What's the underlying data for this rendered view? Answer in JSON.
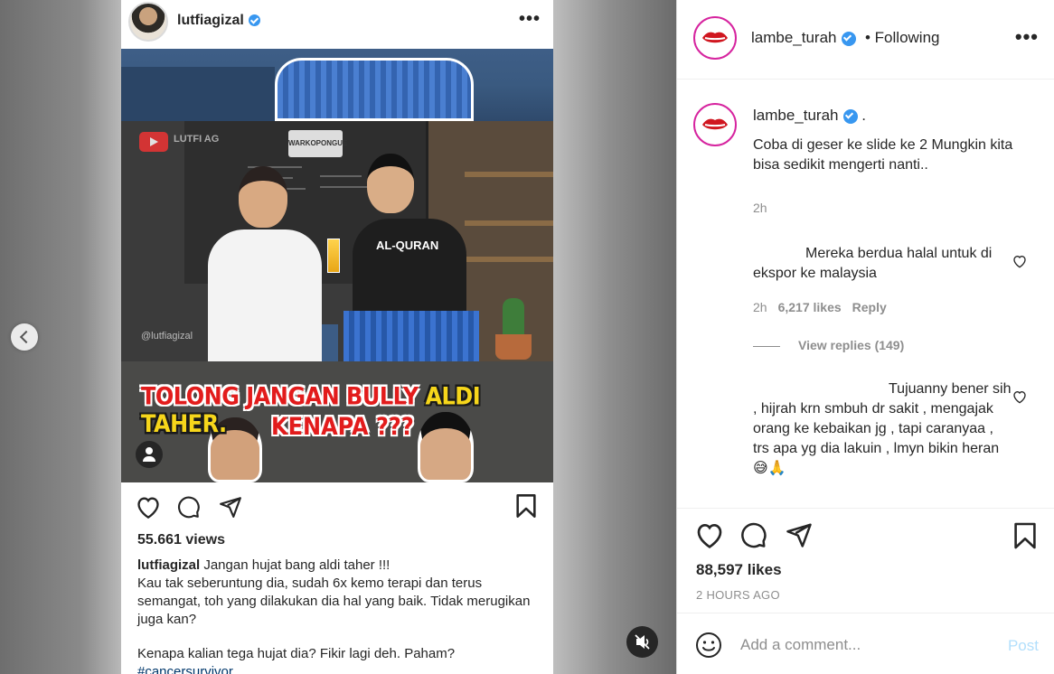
{
  "post_author": {
    "username": "lambe_turah",
    "follow_status": "• Following"
  },
  "media": {
    "repost": {
      "username": "lutfiagizal",
      "views": "55.661 views",
      "caption_user": "lutfiagizal",
      "caption_line1": "Jangan hujat bang aldi taher !!!",
      "caption_line2": "Kau tak seberuntung dia, sudah 6x kemo terapi dan terus semangat, toh yang dilakukan dia hal yang baik. Tidak merugikan juga kan?",
      "caption_line3": "Kenapa kalian tega hujat dia? Fikir lagi deh. Paham?",
      "hashtag": "#cancersurvivor",
      "overlay_text_a": "TOLONG JANGAN BULLY",
      "overlay_text_b": "ALDI TAHER.",
      "overlay_text_c": "KENAPA ???",
      "shirt_text": "AL-QURAN",
      "yt_watermark": "LUTFI AG",
      "ig_watermark": "@lutfiagizal",
      "sign_text": "WARKOPONGUE"
    }
  },
  "caption": {
    "username": "lambe_turah",
    "suffix": ".",
    "text": "Coba di geser ke slide ke 2 Mungkin kita bisa sedikit mengerti nanti..",
    "time": "2h"
  },
  "comments": [
    {
      "text": "Mereka berdua halal untuk di ekspor ke malaysia",
      "time": "2h",
      "likes": "6,217 likes",
      "reply_label": "Reply",
      "view_replies": "View replies (149)"
    },
    {
      "text": "Tujuanny bener sih , hijrah krn smbuh dr sakit , mengajak orang ke kebaikan jg , tapi caranyaa , trs apa yg dia lakuin , lmyn bikin heran 😅🙏"
    }
  ],
  "footer": {
    "likes": "88,597 likes",
    "time": "2 HOURS AGO",
    "comment_placeholder": "Add a comment...",
    "post_label": "Post"
  },
  "colors": {
    "verified": "#3897f0",
    "post_disabled": "#b2dffc",
    "meta_gray": "#8e8e8e",
    "overlay_red": "#e21c1c",
    "overlay_yellow": "#f6d61b"
  },
  "icons": [
    "heart-icon",
    "comment-icon",
    "share-icon",
    "bookmark-icon",
    "more-icon",
    "verified-icon",
    "chevron-left-icon",
    "mute-icon",
    "emoji-icon",
    "user-tag-icon"
  ]
}
